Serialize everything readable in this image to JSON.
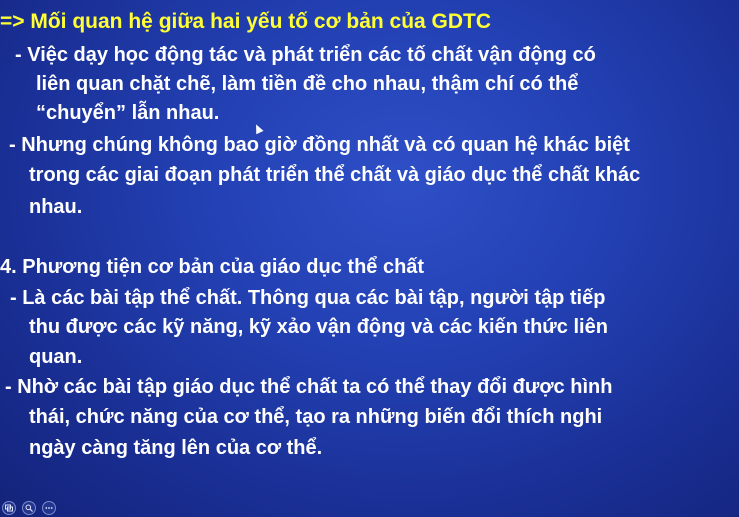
{
  "slide": {
    "lines": [
      "=> Mối quan hệ giữa hai yếu tố cơ bản của GDTC",
      "-  Việc dạy học động tác và phát triển các tố chất vận động có",
      "liên quan chặt chẽ, làm tiền đề cho nhau, thậm chí có thể",
      "“chuyển” lẫn nhau.",
      "-  Nhưng chúng không bao giờ đồng nhất và có quan hệ khác biệt",
      "trong các giai đoạn phát triển thể chất và giáo dục thể chất khác",
      "nhau.",
      "4.  Phương tiện cơ bản của giáo dục thể chất",
      "-  Là các bài tập  thể chất. Thông qua các bài tập, người tập tiếp",
      "thu được các kỹ năng, kỹ xảo vận động và các kiến thức liên",
      "quan.",
      "-   Nhờ các bài tập giáo dục thể chất ta có thể thay đổi được hình",
      "thái, chức năng của cơ thể, tạo ra những biến đổi thích nghi",
      "ngày càng tăng lên của cơ thể."
    ]
  },
  "toolbar": {
    "buttons": [
      "slides-icon",
      "zoom-icon",
      "more-icon"
    ]
  },
  "colors": {
    "title": "#ffff33",
    "text": "#ffffff",
    "background": "#2341b4"
  }
}
